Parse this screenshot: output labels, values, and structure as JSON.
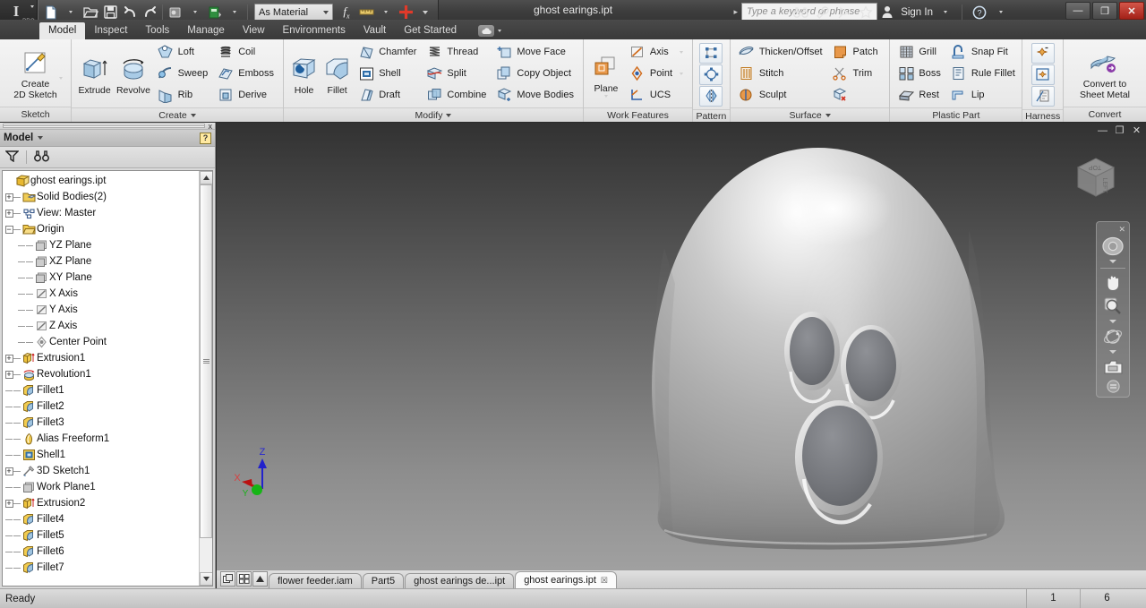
{
  "app": {
    "logo_text": "I",
    "logo_sub": "PRO",
    "document_title": "ghost earings.ipt"
  },
  "quick_access": {
    "items": [
      {
        "name": "new-file",
        "icon": "new-document-icon",
        "has_caret": true
      },
      {
        "name": "open-file",
        "icon": "open-folder-icon",
        "has_caret": false
      },
      {
        "name": "save-file",
        "icon": "save-disk-icon",
        "has_caret": false
      },
      {
        "name": "undo",
        "icon": "undo-arrow-icon",
        "has_caret": false
      },
      {
        "name": "redo",
        "icon": "redo-arrow-icon",
        "has_caret": false
      },
      {
        "name": "appearance",
        "icon": "appearance-icon",
        "has_caret": true
      },
      {
        "name": "return",
        "icon": "return-green-icon",
        "has_caret": true
      }
    ],
    "material_value": "As Material",
    "parameters_icon": "fx-parameters-icon",
    "measure_icon": "measure-ruler-icon",
    "plus_icon": "red-plus-icon"
  },
  "search": {
    "placeholder": "Type a keyword or phrase",
    "icons": [
      "binoculars-icon",
      "wrench-icon",
      "satellite-dish-icon",
      "star-icon",
      "person-icon"
    ],
    "signin_label": "Sign In",
    "help_icon": "question-help-icon"
  },
  "window_controls": {
    "minimize": "—",
    "maximize": "❐",
    "close": "✕"
  },
  "ribbon_tabs": {
    "items": [
      {
        "label": "Model",
        "active": true
      },
      {
        "label": "Inspect",
        "active": false
      },
      {
        "label": "Tools",
        "active": false
      },
      {
        "label": "Manage",
        "active": false
      },
      {
        "label": "View",
        "active": false
      },
      {
        "label": "Environments",
        "active": false
      },
      {
        "label": "Vault",
        "active": false
      },
      {
        "label": "Get Started",
        "active": false
      }
    ],
    "cloud_icon": "cloud-icon"
  },
  "ribbon": {
    "panels": [
      {
        "title": "Sketch",
        "has_caret": false,
        "big_buttons": [
          {
            "label": "Create\n2D Sketch",
            "icon": "create-sketch-icon",
            "has_caret": true
          }
        ],
        "small_groups": []
      },
      {
        "title": "Create",
        "has_caret": true,
        "big_buttons": [
          {
            "label": "Extrude",
            "icon": "extrude-icon",
            "has_caret": false
          },
          {
            "label": "Revolve",
            "icon": "revolve-icon",
            "has_caret": false
          }
        ],
        "small_groups": [
          [
            {
              "label": "Loft",
              "icon": "loft-icon"
            },
            {
              "label": "Sweep",
              "icon": "sweep-icon"
            },
            {
              "label": "Rib",
              "icon": "rib-icon"
            }
          ],
          [
            {
              "label": "Coil",
              "icon": "coil-icon"
            },
            {
              "label": "Emboss",
              "icon": "emboss-icon"
            },
            {
              "label": "Derive",
              "icon": "derive-icon"
            }
          ]
        ]
      },
      {
        "title": "Modify",
        "has_caret": true,
        "big_buttons": [
          {
            "label": "Hole",
            "icon": "hole-icon",
            "has_caret": false
          },
          {
            "label": "Fillet",
            "icon": "fillet-icon",
            "has_caret": false
          }
        ],
        "small_groups": [
          [
            {
              "label": "Chamfer",
              "icon": "chamfer-icon"
            },
            {
              "label": "Shell",
              "icon": "shell-icon"
            },
            {
              "label": "Draft",
              "icon": "draft-icon"
            }
          ],
          [
            {
              "label": "Thread",
              "icon": "thread-icon"
            },
            {
              "label": "Split",
              "icon": "split-icon"
            },
            {
              "label": "Combine",
              "icon": "combine-icon"
            }
          ],
          [
            {
              "label": "Move Face",
              "icon": "move-face-icon"
            },
            {
              "label": "Copy Object",
              "icon": "copy-object-icon"
            },
            {
              "label": "Move Bodies",
              "icon": "move-bodies-icon"
            }
          ]
        ]
      },
      {
        "title": "Work Features",
        "has_caret": false,
        "big_buttons": [
          {
            "label": "Plane",
            "icon": "work-plane-icon",
            "has_caret": true
          }
        ],
        "small_groups": [
          [
            {
              "label": "Axis",
              "icon": "work-axis-icon",
              "has_caret": true
            },
            {
              "label": "Point",
              "icon": "work-point-icon",
              "has_caret": true
            },
            {
              "label": "UCS",
              "icon": "ucs-icon",
              "has_caret": false
            }
          ]
        ]
      },
      {
        "title": "Pattern",
        "has_caret": false,
        "icon_buttons": [
          "rectangular-pattern-icon",
          "circular-pattern-icon",
          "mirror-icon"
        ]
      },
      {
        "title": "Surface",
        "has_caret": true,
        "small_groups": [
          [
            {
              "label": "Thicken/Offset",
              "icon": "thicken-offset-icon"
            },
            {
              "label": "Stitch",
              "icon": "stitch-icon"
            },
            {
              "label": "Sculpt",
              "icon": "sculpt-icon"
            }
          ],
          [
            {
              "label": "Patch",
              "icon": "patch-icon"
            },
            {
              "label": "Trim",
              "icon": "trim-scissors-icon"
            },
            {
              "label": "",
              "icon": "delete-face-icon"
            }
          ]
        ]
      },
      {
        "title": "Plastic Part",
        "has_caret": false,
        "small_groups": [
          [
            {
              "label": "Grill",
              "icon": "grill-icon"
            },
            {
              "label": "Boss",
              "icon": "boss-icon"
            },
            {
              "label": "Rest",
              "icon": "rest-icon"
            }
          ],
          [
            {
              "label": "Snap Fit",
              "icon": "snap-fit-icon"
            },
            {
              "label": "Rule Fillet",
              "icon": "rule-fillet-icon"
            },
            {
              "label": "Lip",
              "icon": "lip-icon"
            }
          ]
        ]
      },
      {
        "title": "Harness",
        "has_caret": false,
        "icon_buttons": [
          "place-pin-icon",
          "create-pin-icon",
          "harness-report-icon"
        ]
      },
      {
        "title": "Convert",
        "has_caret": false,
        "big_buttons": [
          {
            "label": "Convert to\nSheet Metal",
            "icon": "convert-sheet-metal-icon",
            "has_caret": false
          }
        ],
        "small_groups": []
      }
    ]
  },
  "browser": {
    "panel_title": "Model",
    "help_badge": "?",
    "close_label": "x",
    "tools": [
      {
        "name": "filter-icon"
      },
      {
        "name": "find-binoculars-icon"
      }
    ],
    "tree": [
      {
        "label": "ghost earings.ipt",
        "icon": "part-file-icon",
        "depth": 0,
        "expander": "none",
        "gutter": false
      },
      {
        "label": "Solid Bodies(2)",
        "icon": "solid-bodies-folder-icon",
        "depth": 1,
        "expander": "plus",
        "gutter": false
      },
      {
        "label": "View: Master",
        "icon": "view-master-icon",
        "depth": 1,
        "expander": "plus",
        "gutter": false
      },
      {
        "label": "Origin",
        "icon": "origin-folder-icon",
        "depth": 1,
        "expander": "minus",
        "gutter": false
      },
      {
        "label": "YZ Plane",
        "icon": "plane-icon",
        "depth": 2,
        "expander": "none",
        "gutter": true
      },
      {
        "label": "XZ Plane",
        "icon": "plane-icon",
        "depth": 2,
        "expander": "none",
        "gutter": true
      },
      {
        "label": "XY Plane",
        "icon": "plane-icon",
        "depth": 2,
        "expander": "none",
        "gutter": true
      },
      {
        "label": "X Axis",
        "icon": "axis-icon",
        "depth": 2,
        "expander": "none",
        "gutter": true
      },
      {
        "label": "Y Axis",
        "icon": "axis-icon",
        "depth": 2,
        "expander": "none",
        "gutter": true
      },
      {
        "label": "Z Axis",
        "icon": "axis-icon",
        "depth": 2,
        "expander": "none",
        "gutter": true
      },
      {
        "label": "Center Point",
        "icon": "center-point-icon",
        "depth": 2,
        "expander": "none",
        "gutter": true
      },
      {
        "label": "Extrusion1",
        "icon": "extrusion-icon",
        "depth": 1,
        "expander": "plus",
        "gutter": false
      },
      {
        "label": "Revolution1",
        "icon": "revolution-icon",
        "depth": 1,
        "expander": "plus",
        "gutter": false
      },
      {
        "label": "Fillet1",
        "icon": "fillet-tree-icon",
        "depth": 1,
        "expander": "none",
        "gutter": false
      },
      {
        "label": "Fillet2",
        "icon": "fillet-tree-icon",
        "depth": 1,
        "expander": "none",
        "gutter": false
      },
      {
        "label": "Fillet3",
        "icon": "fillet-tree-icon",
        "depth": 1,
        "expander": "none",
        "gutter": false
      },
      {
        "label": "Alias Freeform1",
        "icon": "alias-freeform-icon",
        "depth": 1,
        "expander": "none",
        "gutter": false
      },
      {
        "label": "Shell1",
        "icon": "shell-tree-icon",
        "depth": 1,
        "expander": "none",
        "gutter": false
      },
      {
        "label": "3D Sketch1",
        "icon": "sketch3d-icon",
        "depth": 1,
        "expander": "plus",
        "gutter": false
      },
      {
        "label": "Work Plane1",
        "icon": "plane-icon",
        "depth": 1,
        "expander": "none",
        "gutter": false
      },
      {
        "label": "Extrusion2",
        "icon": "extrusion-icon",
        "depth": 1,
        "expander": "plus",
        "gutter": false
      },
      {
        "label": "Fillet4",
        "icon": "fillet-tree-icon",
        "depth": 1,
        "expander": "none",
        "gutter": false
      },
      {
        "label": "Fillet5",
        "icon": "fillet-tree-icon",
        "depth": 1,
        "expander": "none",
        "gutter": false
      },
      {
        "label": "Fillet6",
        "icon": "fillet-tree-icon",
        "depth": 1,
        "expander": "none",
        "gutter": false
      },
      {
        "label": "Fillet7",
        "icon": "fillet-tree-icon",
        "depth": 1,
        "expander": "none",
        "gutter": false
      }
    ]
  },
  "viewport": {
    "model_name": "ghost-3d-model",
    "background_top": "#323232",
    "background_bottom": "#a0a0a0",
    "viewcube_faces": {
      "top": "TOP",
      "front": "FRONT",
      "right": "LEFT"
    },
    "nav_items": [
      {
        "name": "steering-wheel-icon"
      },
      {
        "name": "pan-hand-icon"
      },
      {
        "name": "zoom-magnifier-icon"
      },
      {
        "name": "orbit-icon"
      },
      {
        "name": "look-at-camera-icon"
      }
    ],
    "nav_close": "✕",
    "nav_settings": "≡",
    "window_controls": {
      "minimize": "—",
      "restore": "❐",
      "close": "✕"
    },
    "axis_labels": {
      "x": "X",
      "y": "Y",
      "z": "Z"
    },
    "axis_colors": {
      "x": "#e05252",
      "y": "#2fbf2f",
      "z": "#3838d8"
    }
  },
  "doc_tabs": {
    "controls": [
      "cascade-windows-icon",
      "tile-windows-icon",
      "scroll-up-icon"
    ],
    "items": [
      {
        "label": "flower feeder.iam",
        "active": false,
        "closable": false
      },
      {
        "label": "Part5",
        "active": false,
        "closable": false
      },
      {
        "label": "ghost earings de...ipt",
        "active": false,
        "closable": false
      },
      {
        "label": "ghost earings.ipt",
        "active": true,
        "closable": true
      }
    ],
    "close_glyph": "☒"
  },
  "status": {
    "message": "Ready",
    "cells": [
      "1",
      "6"
    ]
  }
}
